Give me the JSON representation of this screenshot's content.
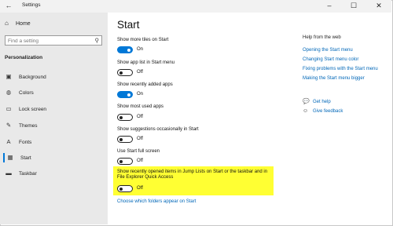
{
  "window": {
    "title": "Settings",
    "minimize": "–",
    "maximize": "☐",
    "close": "✕"
  },
  "sidebar": {
    "home_label": "Home",
    "search": {
      "placeholder": "Find a setting"
    },
    "section_label": "Personalization",
    "items": [
      {
        "label": "Background",
        "icon": "image-icon"
      },
      {
        "label": "Colors",
        "icon": "palette-icon"
      },
      {
        "label": "Lock screen",
        "icon": "lock-screen-icon"
      },
      {
        "label": "Themes",
        "icon": "brush-icon"
      },
      {
        "label": "Fonts",
        "icon": "font-icon"
      },
      {
        "label": "Start",
        "icon": "start-icon"
      },
      {
        "label": "Taskbar",
        "icon": "taskbar-icon"
      }
    ],
    "active_item": "Start"
  },
  "main": {
    "title": "Start",
    "settings": [
      {
        "label": "Show more tiles on Start",
        "state": "On"
      },
      {
        "label": "Show app list in Start menu",
        "state": "Off"
      },
      {
        "label": "Show recently added apps",
        "state": "On"
      },
      {
        "label": "Show most used apps",
        "state": "Off"
      },
      {
        "label": "Show suggestions occasionally in Start",
        "state": "Off"
      },
      {
        "label": "Use Start full screen",
        "state": "Off"
      },
      {
        "label_line1": "Show recently opened items in Jump Lists on Start or the taskbar and in",
        "label_line2": "File Explorer Quick Access",
        "state": "Off"
      }
    ],
    "link": "Choose which folders appear on Start",
    "highlight_color": "#ffff33",
    "accent_color": "#0078d7"
  },
  "help": {
    "title": "Help from the web",
    "links": [
      "Opening the Start menu",
      "Changing Start menu color",
      "Fixing problems with the Start menu",
      "Making the Start menu bigger"
    ],
    "get_help": "Get help",
    "give_feedback": "Give feedback"
  }
}
